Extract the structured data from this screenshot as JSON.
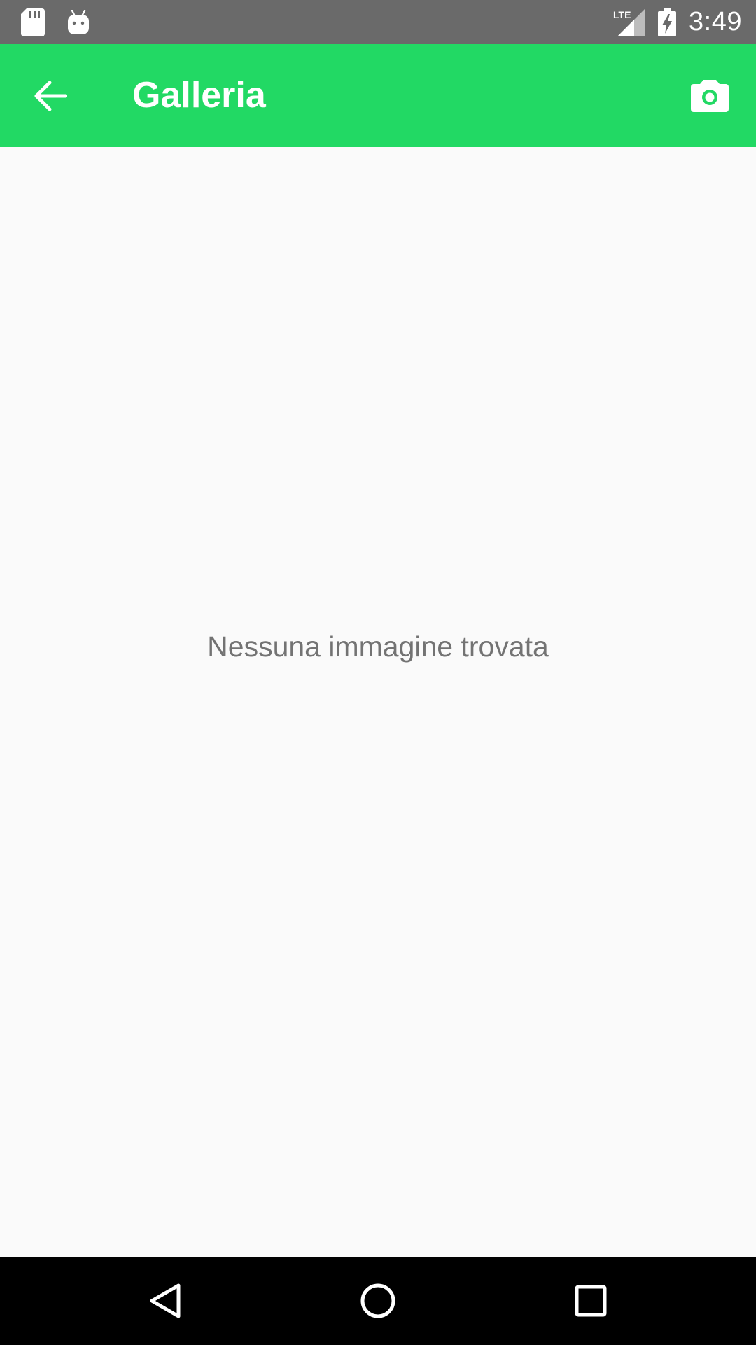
{
  "status_bar": {
    "time": "3:49",
    "network_label": "LTE",
    "icons": [
      "sd-card-icon",
      "android-debug-icon",
      "lte-signal-icon",
      "battery-charging-icon"
    ]
  },
  "app_bar": {
    "title": "Galleria",
    "background_color": "#22d964",
    "icons": [
      "back-arrow-icon",
      "camera-icon"
    ]
  },
  "content": {
    "empty_message": "Nessuna immagine trovata"
  },
  "nav_bar": {
    "icons": [
      "nav-back-icon",
      "nav-home-icon",
      "nav-recents-icon"
    ]
  },
  "colors": {
    "status_bar": "#6a6a6a",
    "accent": "#22d964",
    "background": "#fafafa",
    "empty_text": "#737373",
    "nav_bar": "#000000"
  }
}
